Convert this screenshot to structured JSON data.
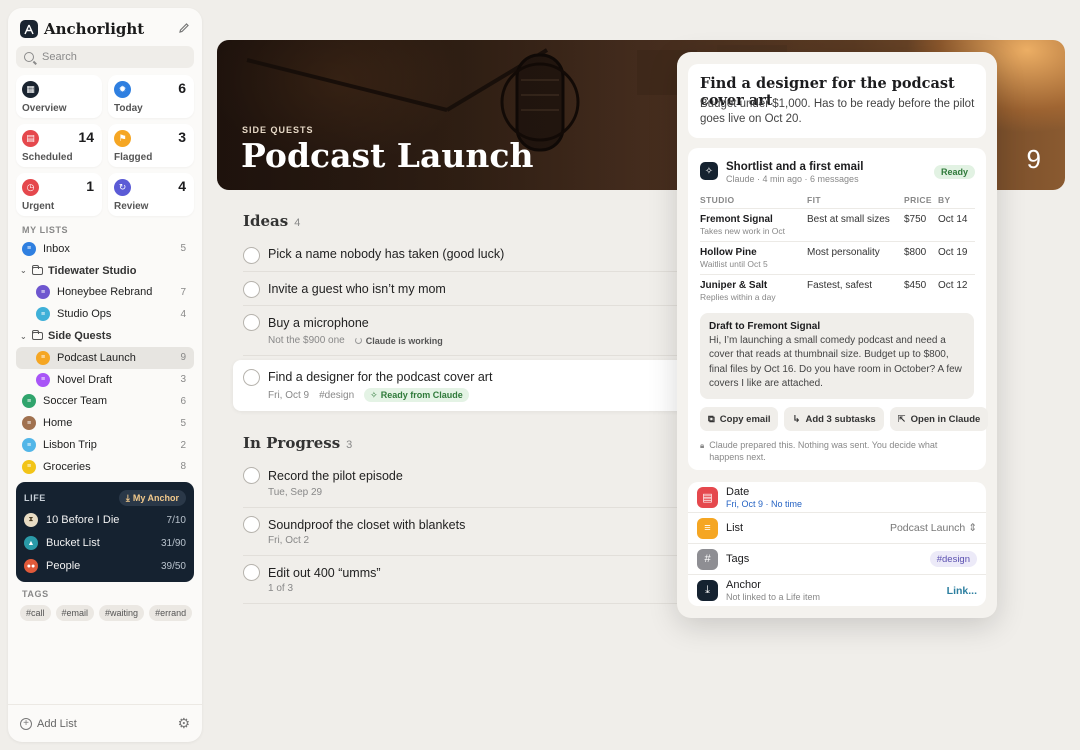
{
  "app": {
    "name": "Anchorlight"
  },
  "search": {
    "placeholder": "Search"
  },
  "smart_lists": [
    {
      "label": "Overview",
      "count": "",
      "color": "#1a2430",
      "icon": "grid-icon"
    },
    {
      "label": "Today",
      "count": "6",
      "color": "#2f7fe0",
      "icon": "sun-icon"
    },
    {
      "label": "Scheduled",
      "count": "14",
      "color": "#e5484d",
      "icon": "calendar-icon"
    },
    {
      "label": "Flagged",
      "count": "3",
      "color": "#f5a623",
      "icon": "flag-icon"
    },
    {
      "label": "Urgent",
      "count": "1",
      "color": "#e5484d",
      "icon": "alarm-icon"
    },
    {
      "label": "Review",
      "count": "4",
      "color": "#5b5bd6",
      "icon": "refresh-icon"
    }
  ],
  "my_lists_label": "MY LISTS",
  "lists": {
    "inbox": {
      "label": "Inbox",
      "count": "5"
    },
    "tidewater": {
      "label": "Tidewater Studio"
    },
    "honeybee": {
      "label": "Honeybee Rebrand",
      "count": "7"
    },
    "studio_ops": {
      "label": "Studio Ops",
      "count": "4"
    },
    "side_quests": {
      "label": "Side Quests"
    },
    "podcast": {
      "label": "Podcast Launch",
      "count": "9"
    },
    "novel": {
      "label": "Novel Draft",
      "count": "3"
    },
    "soccer": {
      "label": "Soccer Team",
      "count": "6"
    },
    "home": {
      "label": "Home",
      "count": "5"
    },
    "lisbon": {
      "label": "Lisbon Trip",
      "count": "2"
    },
    "groceries": {
      "label": "Groceries",
      "count": "8"
    }
  },
  "life": {
    "title": "LIFE",
    "anchor_label": "My Anchor",
    "items": [
      {
        "label": "10 Before I Die",
        "progress": "7/10"
      },
      {
        "label": "Bucket List",
        "progress": "31/90"
      },
      {
        "label": "People",
        "progress": "39/50"
      }
    ]
  },
  "tags_label": "TAGS",
  "tags": [
    "#call",
    "#email",
    "#waiting",
    "#errand"
  ],
  "footer": {
    "add_list": "Add List"
  },
  "hero": {
    "eyebrow": "SIDE QUESTS",
    "title": "Podcast Launch",
    "count": "9"
  },
  "groups": {
    "ideas": {
      "title": "Ideas",
      "count": "4"
    },
    "in_progress": {
      "title": "In Progress",
      "count": "3"
    }
  },
  "tasks": {
    "t1": {
      "title": "Pick a name nobody has taken (good luck)"
    },
    "t2": {
      "title": "Invite a guest who isn’t my mom"
    },
    "t3": {
      "title": "Buy a microphone",
      "note": "Not the $900 one",
      "status": "Claude is working"
    },
    "t4": {
      "title": "Find a designer for the podcast cover art",
      "date": "Fri, Oct 9",
      "tag": "#design",
      "badge": "Ready from Claude"
    },
    "t5": {
      "title": "Record the pilot episode",
      "date": "Tue, Sep 29"
    },
    "t6": {
      "title": "Soundproof the closet with blankets",
      "date": "Fri, Oct 2"
    },
    "t7": {
      "title": "Edit out 400 “umms”",
      "note": "1 of 3"
    }
  },
  "detail": {
    "title": "Find a designer for the podcast cover art",
    "description": "Budget under $1,000. Has to be ready before the pilot goes live on Oct 20.",
    "ai": {
      "title": "Shortlist and a first email",
      "meta": "Claude · 4 min ago · 6 messages",
      "badge": "Ready",
      "headers": {
        "studio": "STUDIO",
        "fit": "FIT",
        "price": "PRICE",
        "by": "BY"
      },
      "rows": [
        {
          "studio": "Fremont Signal",
          "note": "Takes new work in Oct",
          "fit": "Best at small sizes",
          "price": "$750",
          "by": "Oct 14"
        },
        {
          "studio": "Hollow Pine",
          "note": "Waitlist until Oct 5",
          "fit": "Most personality",
          "price": "$800",
          "by": "Oct 19"
        },
        {
          "studio": "Juniper & Salt",
          "note": "Replies within a day",
          "fit": "Fastest, safest",
          "price": "$450",
          "by": "Oct 12"
        }
      ],
      "draft_title": "Draft to Fremont Signal",
      "draft_body": "Hi, I’m launching a small comedy podcast and need a cover that reads at thumbnail size. Budget up to $800, final files by Oct 16. Do you have room in October? A few covers I like are attached.",
      "actions": {
        "copy": "Copy email",
        "subtasks": "Add 3 subtasks",
        "open": "Open in Claude"
      },
      "disclaimer": "Claude prepared this. Nothing was sent. You decide what happens next."
    },
    "props": {
      "date_label": "Date",
      "date_value": "Fri, Oct 9 · No time",
      "list_label": "List",
      "list_value": "Podcast Launch",
      "tags_label": "Tags",
      "tag_value": "#design",
      "anchor_label": "Anchor",
      "anchor_sub": "Not linked to a Life item",
      "anchor_link": "Link..."
    }
  }
}
